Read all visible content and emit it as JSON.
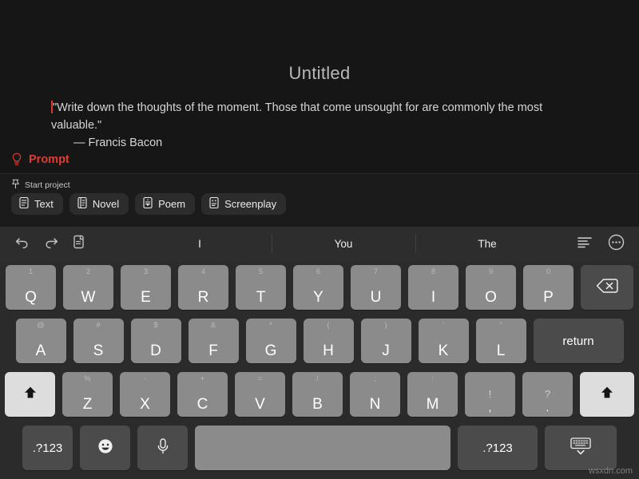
{
  "document": {
    "title": "Untitled",
    "body": "\"Write down the thoughts of the moment. Those that come unsought for are commonly the most valuable.\"",
    "attribution": "— Francis Bacon"
  },
  "prompt": {
    "label": "Prompt",
    "icon": "lightbulb-icon",
    "color": "#e03c31"
  },
  "project": {
    "start_label": "Start project",
    "pin_icon": "pin-icon",
    "chips": [
      {
        "label": "Text",
        "icon": "document-text-icon"
      },
      {
        "label": "Novel",
        "icon": "book-icon"
      },
      {
        "label": "Poem",
        "icon": "document-poem-icon"
      },
      {
        "label": "Screenplay",
        "icon": "document-screenplay-icon"
      }
    ]
  },
  "keyboard": {
    "toolbar": {
      "undo_icon": "undo-icon",
      "redo_icon": "redo-icon",
      "paste_icon": "paste-icon",
      "format_icon": "text-format-icon",
      "more_icon": "more-circle-icon",
      "suggestions": [
        "I",
        "You",
        "The"
      ]
    },
    "row1": [
      {
        "alt": "1",
        "main": "Q"
      },
      {
        "alt": "2",
        "main": "W"
      },
      {
        "alt": "3",
        "main": "E"
      },
      {
        "alt": "4",
        "main": "R"
      },
      {
        "alt": "5",
        "main": "T"
      },
      {
        "alt": "6",
        "main": "Y"
      },
      {
        "alt": "7",
        "main": "U"
      },
      {
        "alt": "8",
        "main": "I"
      },
      {
        "alt": "9",
        "main": "O"
      },
      {
        "alt": "0",
        "main": "P"
      }
    ],
    "backspace_icon": "backspace-icon",
    "row2": [
      {
        "alt": "@",
        "main": "A"
      },
      {
        "alt": "#",
        "main": "S"
      },
      {
        "alt": "$",
        "main": "D"
      },
      {
        "alt": "&",
        "main": "F"
      },
      {
        "alt": "*",
        "main": "G"
      },
      {
        "alt": "(",
        "main": "H"
      },
      {
        "alt": ")",
        "main": "J"
      },
      {
        "alt": "'",
        "main": "K"
      },
      {
        "alt": "\"",
        "main": "L"
      }
    ],
    "return_label": "return",
    "row3": [
      {
        "alt": "%",
        "main": "Z"
      },
      {
        "alt": "-",
        "main": "X"
      },
      {
        "alt": "+",
        "main": "C"
      },
      {
        "alt": "=",
        "main": "V"
      },
      {
        "alt": "/",
        "main": "B"
      },
      {
        "alt": ";",
        "main": "N"
      },
      {
        "alt": ":",
        "main": "M"
      }
    ],
    "punct1": {
      "top": "!",
      "bottom": ","
    },
    "punct2": {
      "top": "?",
      "bottom": "."
    },
    "shift_icon": "shift-icon",
    "row4": {
      "numbers_left": ".?123",
      "emoji_icon": "emoji-icon",
      "mic_icon": "microphone-icon",
      "space_label": "",
      "numbers_right": ".?123",
      "dismiss_icon": "dismiss-keyboard-icon"
    }
  },
  "watermark": "wsxdn.com"
}
